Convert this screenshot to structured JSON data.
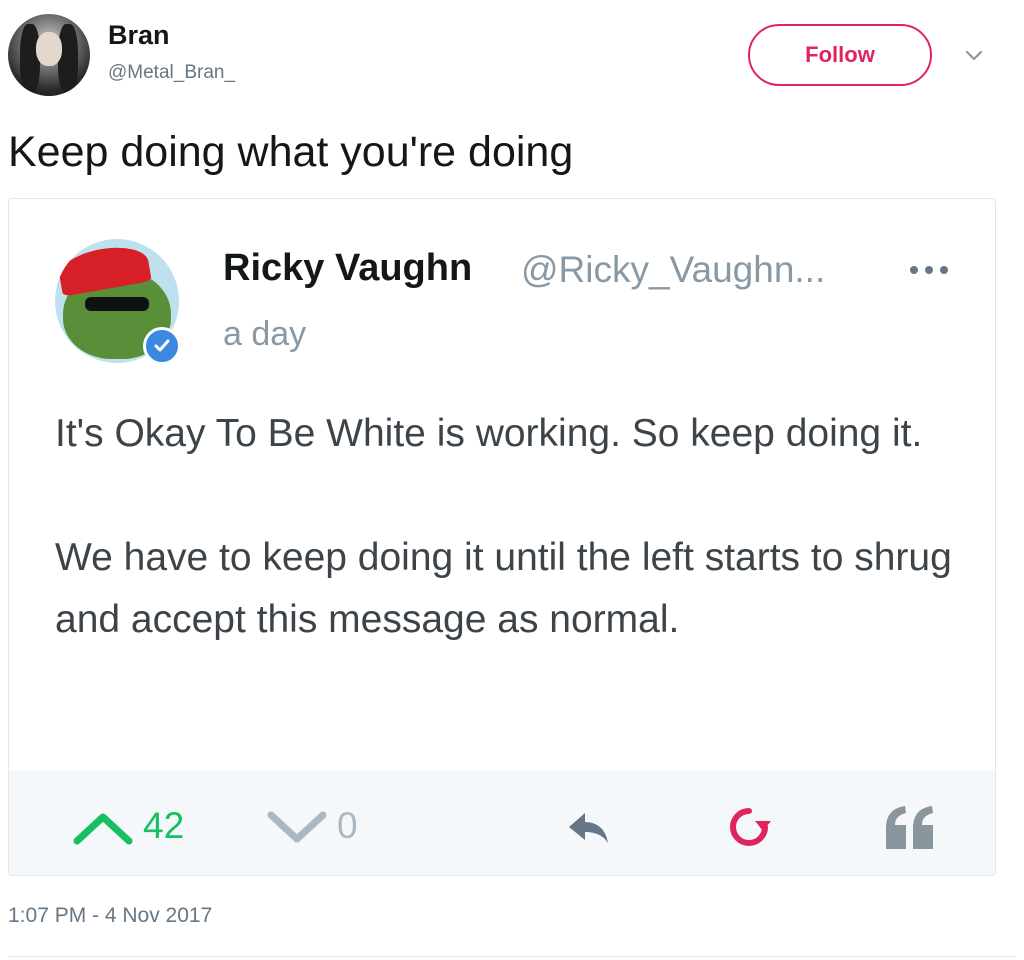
{
  "tweet": {
    "author": {
      "name": "Bran",
      "handle": "@Metal_Bran_"
    },
    "follow_label": "Follow",
    "text": "Keep doing what you're doing",
    "timestamp": "1:07 PM - 4 Nov 2017"
  },
  "quoted": {
    "author": {
      "name": "Ricky Vaughn",
      "handle": "@Ricky_Vaughn...",
      "verified": true
    },
    "time": "a day",
    "paragraphs": [
      "It's Okay To Be White is working. So keep doing it.",
      "We have to keep doing it until the left starts to shrug and accept this message as normal."
    ],
    "actions": {
      "upvotes": "42",
      "downvotes": "0",
      "icons": [
        "upvote-icon",
        "downvote-icon",
        "reply-icon",
        "retweet-icon",
        "quote-icon"
      ]
    }
  },
  "colors": {
    "follow_accent": "#e0245e",
    "upvote": "#17bf63",
    "muted": "#aab8c2",
    "verified": "#3b88e0",
    "retweet": "#e0245e"
  }
}
